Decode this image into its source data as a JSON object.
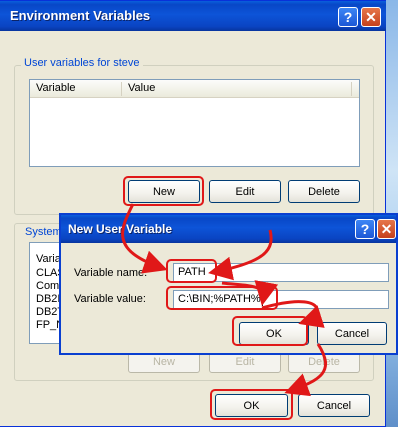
{
  "main_window": {
    "title": "Environment Variables",
    "help_icon": "?",
    "close_icon": "✕",
    "user_group_label": "User variables for steve",
    "columns": [
      "Variable",
      "Value"
    ],
    "buttons": {
      "new": "New",
      "edit": "Edit",
      "delete": "Delete"
    },
    "system_group_label": "System",
    "system_rows": [
      "Varia",
      "CLAS",
      "Com9",
      "DB2IE",
      "DB2T",
      "FP_N"
    ],
    "system_buttons": {
      "new": "New",
      "edit": "Edit",
      "delete": "Delete"
    },
    "ok_label": "OK",
    "cancel_label": "Cancel"
  },
  "dialog": {
    "title": "New User Variable",
    "help_icon": "?",
    "close_icon": "✕",
    "name_label": "Variable name:",
    "name_value": "PATH",
    "value_label": "Variable value:",
    "value_value": "C:\\BIN;%PATH%",
    "ok_label": "OK",
    "cancel_label": "Cancel"
  },
  "colors": {
    "annotation": "#e01818",
    "titlebar": "#0a44c2",
    "group_label": "#0046d5"
  }
}
